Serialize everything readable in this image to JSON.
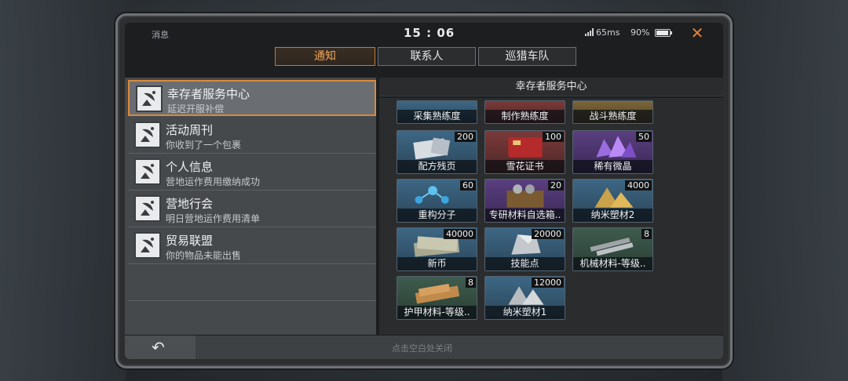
{
  "status": {
    "title": "消息",
    "clock": "15 : 06",
    "ping": "65ms",
    "battery": "90%"
  },
  "tabs": [
    {
      "label": "通知",
      "active": true
    },
    {
      "label": "联系人",
      "active": false
    },
    {
      "label": "巡猎车队",
      "active": false
    }
  ],
  "messages": [
    {
      "name": "幸存者服务中心",
      "sub": "延迟开服补偿",
      "active": true
    },
    {
      "name": "活动周刊",
      "sub": "你收到了一个包裹",
      "active": false
    },
    {
      "name": "个人信息",
      "sub": "营地运作费用缴纳成功",
      "active": false
    },
    {
      "name": "营地行会",
      "sub": "明日营地运作费用清单",
      "active": false
    },
    {
      "name": "贸易联盟",
      "sub": "你的物品未能出售",
      "active": false
    }
  ],
  "panel": {
    "title": "幸存者服务中心"
  },
  "items": [
    {
      "label": "采集熟练度",
      "qty": "",
      "color": "blue"
    },
    {
      "label": "制作熟练度",
      "qty": "",
      "color": "red"
    },
    {
      "label": "战斗熟练度",
      "qty": "",
      "color": "gold"
    },
    {
      "label": "配方残页",
      "qty": "200",
      "color": "blue"
    },
    {
      "label": "雪花证书",
      "qty": "100",
      "color": "red"
    },
    {
      "label": "稀有微晶",
      "qty": "50",
      "color": "purple"
    },
    {
      "label": "重构分子",
      "qty": "60",
      "color": "blue"
    },
    {
      "label": "专研材料自选箱..",
      "qty": "20",
      "color": "purple"
    },
    {
      "label": "纳米塑材2",
      "qty": "4000",
      "color": "blue"
    },
    {
      "label": "新币",
      "qty": "40000",
      "color": "blue"
    },
    {
      "label": "技能点",
      "qty": "20000",
      "color": "blue"
    },
    {
      "label": "机械材料-等级..",
      "qty": "8",
      "color": "green"
    },
    {
      "label": "护甲材料-等级..",
      "qty": "8",
      "color": "green"
    },
    {
      "label": "纳米塑材1",
      "qty": "12000",
      "color": "blue"
    }
  ],
  "bottom": {
    "back_icon": "back-arrow-icon",
    "hint": "点击空白处关闭"
  },
  "colors": {
    "accent": "#d98a3c",
    "close": "#e0823a"
  }
}
